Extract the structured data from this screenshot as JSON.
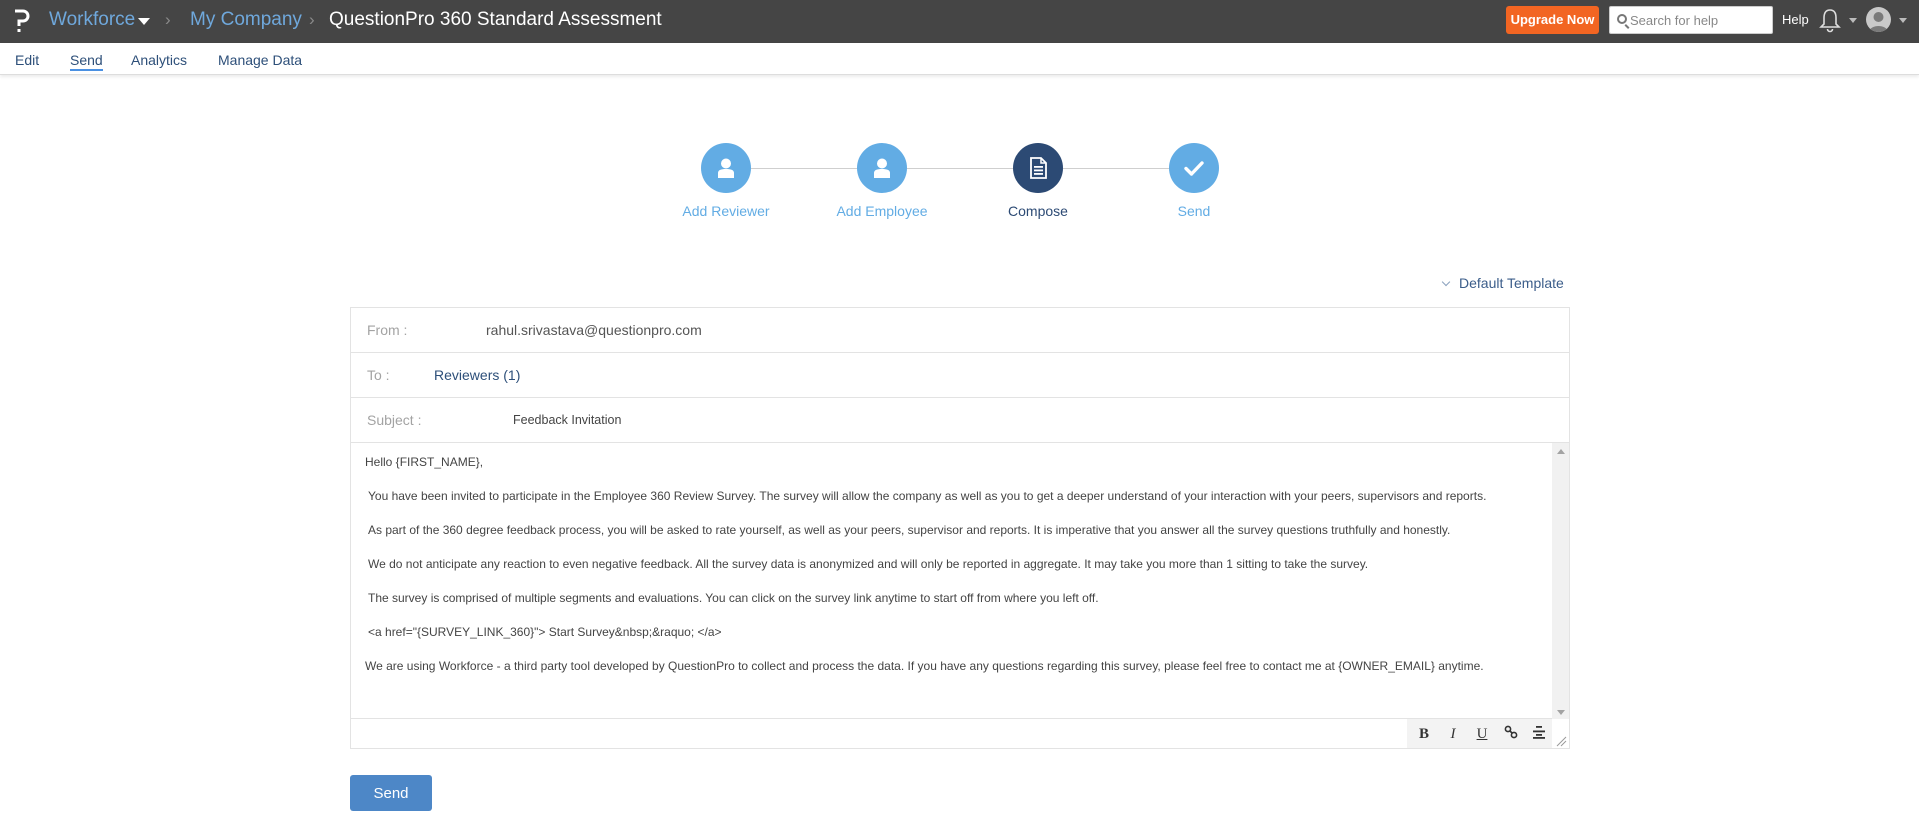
{
  "header": {
    "breadcrumbs": [
      {
        "label": "Workforce",
        "has_dropdown": true
      },
      {
        "label": "My Company"
      },
      {
        "label": "QuestionPro 360 Standard Assessment"
      }
    ],
    "upgrade_label": "Upgrade Now",
    "search_placeholder": "Search for help",
    "help_label": "Help",
    "icons": [
      "logo-icon",
      "bell-icon",
      "avatar-icon"
    ]
  },
  "subnav": {
    "tabs": [
      {
        "label": "Edit"
      },
      {
        "label": "Send",
        "active": true
      },
      {
        "label": "Analytics"
      },
      {
        "label": "Manage Data"
      }
    ]
  },
  "stepper": {
    "steps": [
      {
        "label": "Add Reviewer",
        "icon": "user-icon"
      },
      {
        "label": "Add Employee",
        "icon": "user-icon"
      },
      {
        "label": "Compose",
        "icon": "document-icon",
        "active": true
      },
      {
        "label": "Send",
        "icon": "check-icon"
      }
    ]
  },
  "template": {
    "label": "Default Template"
  },
  "email": {
    "from_label": "From :",
    "from_value": "rahul.srivastava@questionpro.com",
    "to_label": "To :",
    "to_value": "Reviewers (1)",
    "subject_label": "Subject :",
    "subject_value": "Feedback Invitation",
    "body": [
      "Hello {FIRST_NAME},",
      "You have been invited to participate in the Employee 360 Review Survey. The survey will allow the company as well as you to get a deeper understand of your interaction with your peers, supervisors and reports.",
      "As part of the 360 degree feedback process, you will be asked to rate yourself, as well as your peers, supervisor and reports. It is imperative that you answer all the survey questions truthfully and honestly.",
      "We do not anticipate any reaction to even negative feedback. All the survey data is anonymized and will only be reported in aggregate. It may take you more than 1 sitting to take the survey.",
      "The survey is comprised of multiple segments and evaluations. You can click on the survey link anytime to start off from where you left off.",
      "<a href=\"{SURVEY_LINK_360}\"> Start Survey&nbsp;&raquo; </a>",
      "We are using Workforce - a third party tool developed by QuestionPro to collect and process the data. If you have any questions regarding this survey, please feel free to contact me at {OWNER_EMAIL} anytime."
    ]
  },
  "toolbar": {
    "bold": "B",
    "italic": "I",
    "underline": "U"
  },
  "send_label": "Send",
  "colors": {
    "header_bg": "#454545",
    "upgrade": "#f26522",
    "step": "#62ace4",
    "step_active": "#2c4a74",
    "send_button": "#4d87c7"
  }
}
